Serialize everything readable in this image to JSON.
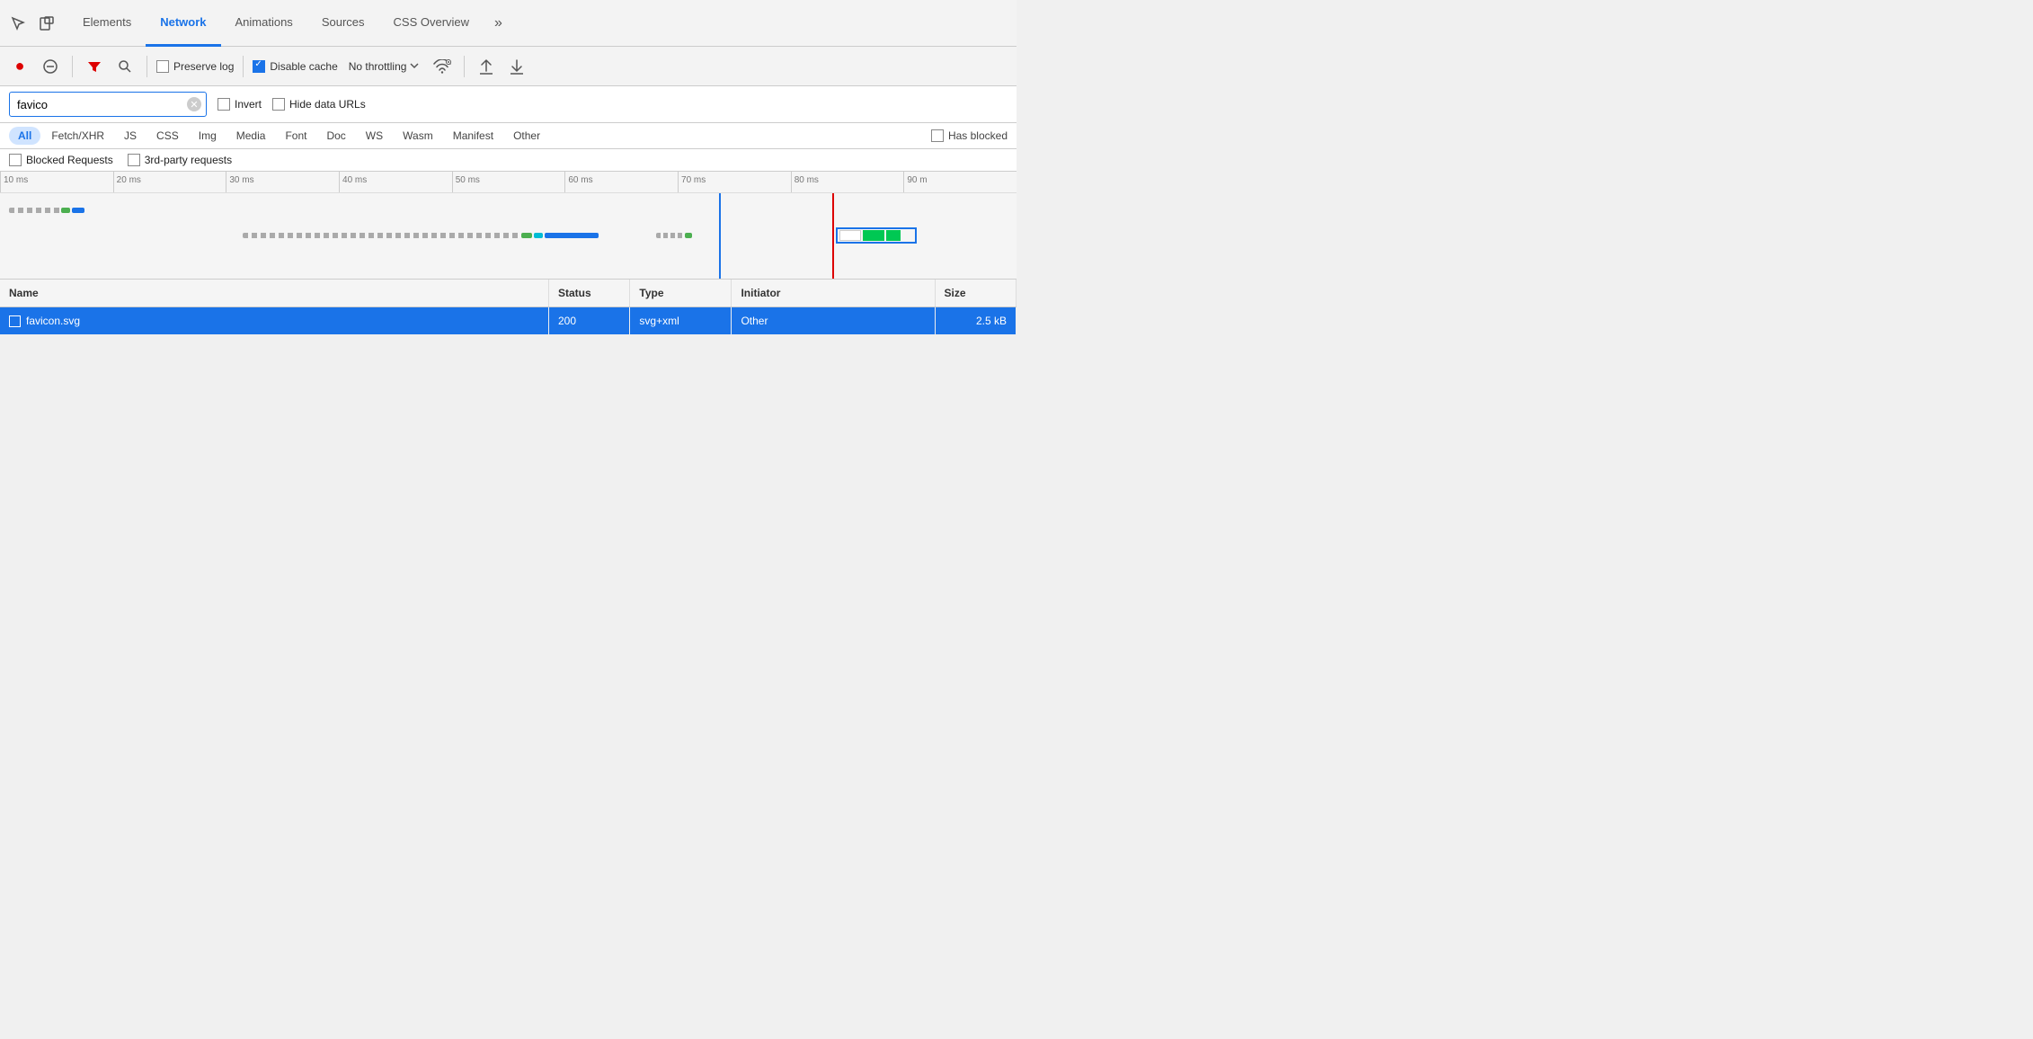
{
  "tabs": [
    {
      "id": "elements",
      "label": "Elements",
      "active": false
    },
    {
      "id": "network",
      "label": "Network",
      "active": true
    },
    {
      "id": "animations",
      "label": "Animations",
      "active": false
    },
    {
      "id": "sources",
      "label": "Sources",
      "active": false
    },
    {
      "id": "css-overview",
      "label": "CSS Overview",
      "active": false
    }
  ],
  "tab_more": "»",
  "toolbar": {
    "record_title": "Record",
    "clear_title": "Clear",
    "filter_title": "Filter",
    "search_title": "Search",
    "preserve_log_label": "Preserve log",
    "preserve_log_checked": false,
    "disable_cache_label": "Disable cache",
    "disable_cache_checked": true,
    "no_throttling_label": "No throttling",
    "import_label": "Import HAR file",
    "export_label": "Export HAR file"
  },
  "filter_bar": {
    "search_value": "favico",
    "search_placeholder": "Filter",
    "invert_label": "Invert",
    "invert_checked": false,
    "hide_data_urls_label": "Hide data URLs",
    "hide_data_urls_checked": false
  },
  "type_filters": [
    {
      "id": "all",
      "label": "All",
      "active": true
    },
    {
      "id": "fetch-xhr",
      "label": "Fetch/XHR",
      "active": false
    },
    {
      "id": "js",
      "label": "JS",
      "active": false
    },
    {
      "id": "css",
      "label": "CSS",
      "active": false
    },
    {
      "id": "img",
      "label": "Img",
      "active": false
    },
    {
      "id": "media",
      "label": "Media",
      "active": false
    },
    {
      "id": "font",
      "label": "Font",
      "active": false
    },
    {
      "id": "doc",
      "label": "Doc",
      "active": false
    },
    {
      "id": "ws",
      "label": "WS",
      "active": false
    },
    {
      "id": "wasm",
      "label": "Wasm",
      "active": false
    },
    {
      "id": "manifest",
      "label": "Manifest",
      "active": false
    },
    {
      "id": "other",
      "label": "Other",
      "active": false
    }
  ],
  "has_blocked_label": "Has blocked",
  "has_blocked_checked": false,
  "blocked_bar": {
    "blocked_requests_label": "Blocked Requests",
    "blocked_requests_checked": false,
    "third_party_label": "3rd-party requests",
    "third_party_checked": false
  },
  "timeline": {
    "ticks": [
      "10 ms",
      "20 ms",
      "30 ms",
      "40 ms",
      "50 ms",
      "60 ms",
      "70 ms",
      "80 ms",
      "90 m"
    ]
  },
  "table": {
    "headers": [
      "Name",
      "Status",
      "Type",
      "Initiator",
      "Size"
    ],
    "rows": [
      {
        "name": "favicon.svg",
        "status": "200",
        "type": "svg+xml",
        "initiator": "Other",
        "size": "2.5 kB",
        "selected": true
      }
    ]
  }
}
